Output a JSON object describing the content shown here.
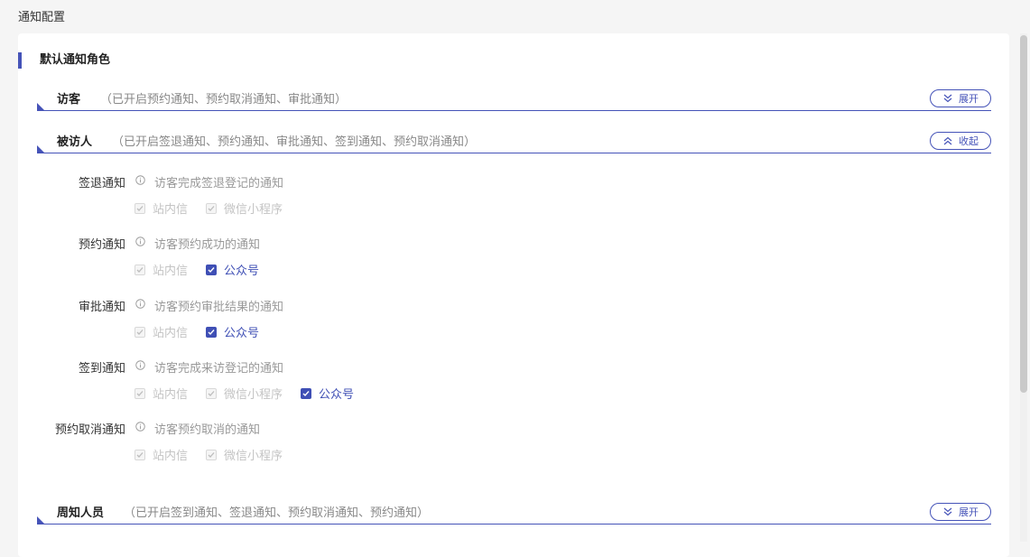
{
  "page_title": "通知配置",
  "section_title": "默认通知角色",
  "roles": [
    {
      "name": "访客",
      "desc": "（已开启预约通知、预约取消通知、审批通知）",
      "toggle": "展开"
    },
    {
      "name": "被访人",
      "desc": "（已开启签退通知、预约通知、审批通知、签到通知、预约取消通知）",
      "toggle": "收起"
    },
    {
      "name": "周知人员",
      "desc": "（已开启签到通知、签退通知、预约取消通知、预约通知）",
      "toggle": "展开"
    }
  ],
  "notices": [
    {
      "label": "签退通知",
      "desc": "访客完成签退登记的通知",
      "options": [
        {
          "label": "站内信",
          "checked": true,
          "disabled": true
        },
        {
          "label": "微信小程序",
          "checked": true,
          "disabled": true
        }
      ]
    },
    {
      "label": "预约通知",
      "desc": "访客预约成功的通知",
      "options": [
        {
          "label": "站内信",
          "checked": true,
          "disabled": true
        },
        {
          "label": "公众号",
          "checked": true,
          "disabled": false
        }
      ]
    },
    {
      "label": "审批通知",
      "desc": "访客预约审批结果的通知",
      "options": [
        {
          "label": "站内信",
          "checked": true,
          "disabled": true
        },
        {
          "label": "公众号",
          "checked": true,
          "disabled": false
        }
      ]
    },
    {
      "label": "签到通知",
      "desc": "访客完成来访登记的通知",
      "options": [
        {
          "label": "站内信",
          "checked": true,
          "disabled": true
        },
        {
          "label": "微信小程序",
          "checked": true,
          "disabled": true
        },
        {
          "label": "公众号",
          "checked": true,
          "disabled": false
        }
      ]
    },
    {
      "label": "预约取消通知",
      "desc": "访客预约取消的通知",
      "options": [
        {
          "label": "站内信",
          "checked": true,
          "disabled": true
        },
        {
          "label": "微信小程序",
          "checked": true,
          "disabled": true
        }
      ]
    }
  ],
  "colors": {
    "accent": "#4553b8",
    "checked": "#3f4fb5",
    "disabled_text": "#c4c4c4"
  }
}
